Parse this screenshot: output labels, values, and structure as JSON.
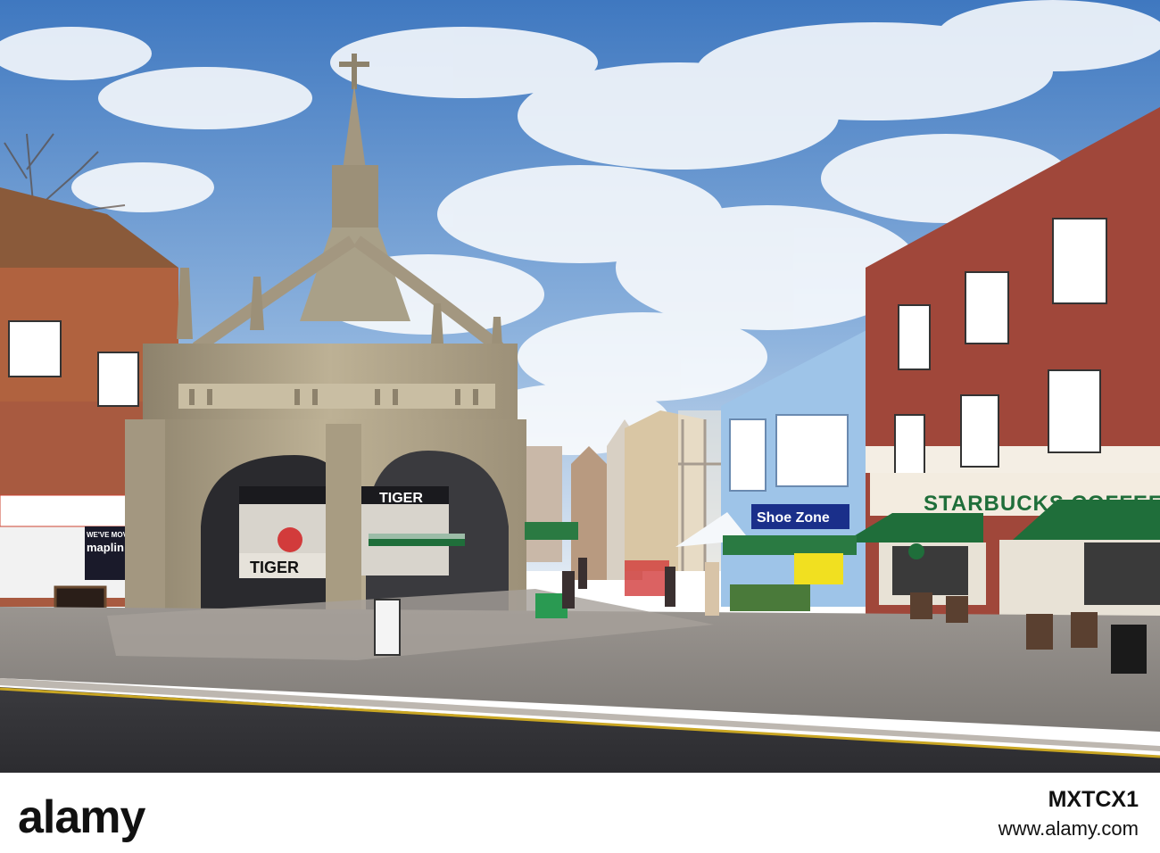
{
  "photo": {
    "signs": {
      "starbucks": "STARBUCKS COFFEE",
      "shoe_zone": "Shoe Zone",
      "tiger_inner": "TIGER",
      "tiger_front": "TIGER",
      "maplin": "maplin",
      "were_moved": "WE'VE MOVED"
    }
  },
  "footer": {
    "brand": "alamy",
    "image_id": "MXTCX1",
    "site": "www.alamy.com"
  },
  "colors": {
    "sky": "#4f86c8",
    "stone": "#b3a68a",
    "brick": "#a0473a",
    "awning_green": "#1f6e3a",
    "blue_building": "#9ec4e8"
  }
}
